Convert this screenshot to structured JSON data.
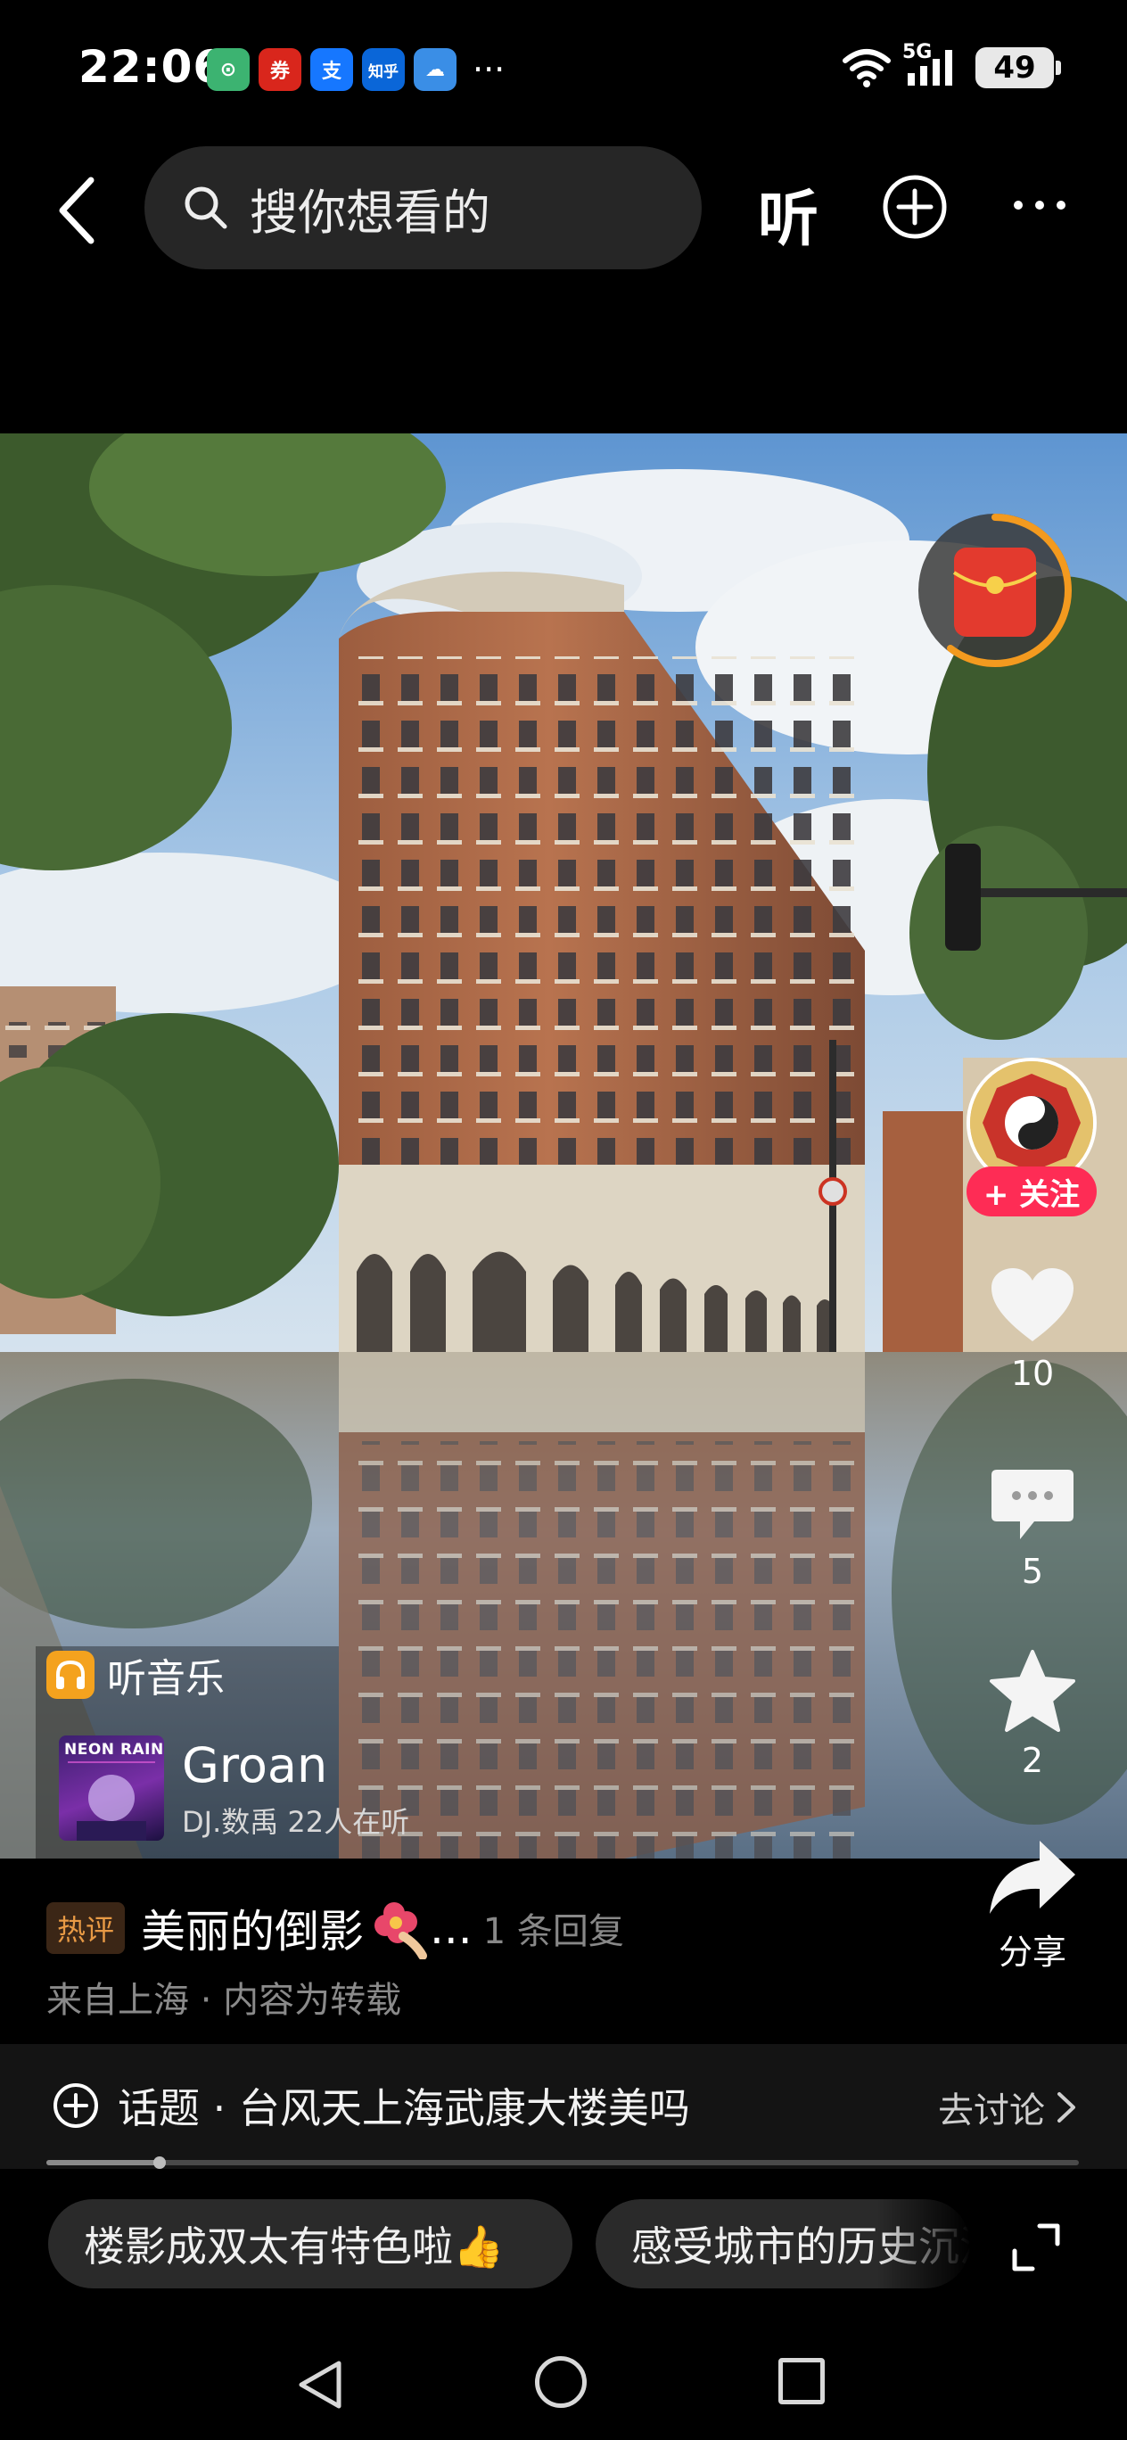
{
  "status_bar": {
    "time": "22:06",
    "app_icons": [
      {
        "name": "app-icon-green",
        "glyph": "⊙",
        "color": "#3cb371"
      },
      {
        "name": "app-icon-securities",
        "glyph": "券",
        "color": "#d9261c"
      },
      {
        "name": "alipay-icon",
        "glyph": "支",
        "color": "#1677ff"
      },
      {
        "name": "zhihu-icon",
        "glyph": "知乎",
        "color": "#0a66d8"
      },
      {
        "name": "weather-icon",
        "glyph": "☁",
        "color": "#3a8ee6"
      }
    ],
    "more": "···",
    "network": "5G",
    "battery": "49"
  },
  "top_nav": {
    "search_placeholder": "搜你想看的",
    "listen_label": "听"
  },
  "music": {
    "header_label": "听音乐",
    "album_text": "NEON RAIN",
    "song_title": "Groan",
    "song_sub": "DJ.数禹 22人在听"
  },
  "actions": {
    "follow_label": "+ 关注",
    "likes": "10",
    "comments": "5",
    "favorites": "2",
    "share_label": "分享"
  },
  "comment": {
    "hot_badge": "热评",
    "hot_text": "美丽的倒影",
    "ellipsis": "...",
    "replies": "1 条回复",
    "from": "来自上海 · 内容为转载"
  },
  "topic": {
    "label": "话题 · 台风天上海武康大楼美吗",
    "action": "去讨论"
  },
  "progress": 0.11,
  "suggestions": [
    "楼影成双太有特色啦👍",
    "感受城市的历史沉淀"
  ],
  "colors": {
    "accent_red": "#fe2c55",
    "hot_badge_text": "#e89a45",
    "music_icon": "#f4a21e"
  }
}
